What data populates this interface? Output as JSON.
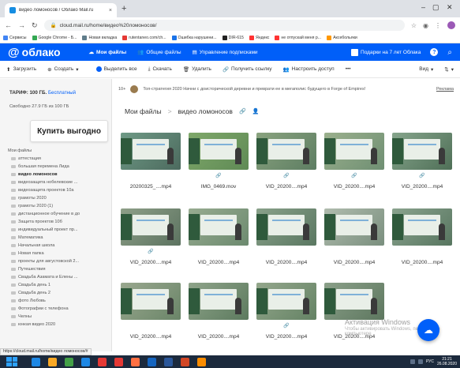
{
  "browser": {
    "tab_title": "видео ломоносов / Облако Mail.ru",
    "tab_close": "×",
    "new_tab": "+",
    "url": "cloud.mail.ru/home/видео%20ломоносов/",
    "bookmarks": [
      {
        "label": "Сервисы",
        "color": "#4285f4"
      },
      {
        "label": "Google Chrome - Б...",
        "color": "#34a853"
      },
      {
        "label": "Новая вкладка",
        "color": "#607d8b"
      },
      {
        "label": "rutentaneo.com/ch...",
        "color": "#e53935"
      },
      {
        "label": "Ошибка нарушени...",
        "color": "#1a73e8"
      },
      {
        "label": "DIR-615",
        "color": "#222222"
      },
      {
        "label": "Яндекс",
        "color": "#ff3333"
      },
      {
        "label": "не отпускай меня р...",
        "color": "#ff3333"
      },
      {
        "label": "Аксебольяки",
        "color": "#ff9800"
      }
    ]
  },
  "cloud": {
    "logo": "облако",
    "logo_at": "@",
    "nav": [
      {
        "label": "Мои файлы",
        "active": true
      },
      {
        "label": "Общие файлы",
        "active": false
      },
      {
        "label": "Управление подписками",
        "active": false
      }
    ],
    "promo_offer": "Подарки на 7 лет Облака",
    "help": "?",
    "search_icon": "⌕"
  },
  "toolbar": {
    "upload": "Загрузить",
    "create": "Создать",
    "select_all": "Выделить все",
    "download": "Скачать",
    "delete": "Удалить",
    "get_link": "Получить ссылку",
    "access": "Настроить доступ",
    "more": "•••",
    "view": "Вид",
    "sort": "⇅"
  },
  "sidebar": {
    "tariff_label": "ТАРИФ: 100 ГБ.",
    "tariff_plan": "Бесплатный",
    "free_space": "Свободно 27.9 ГБ из 100 ГБ",
    "buy_button": "Купить выгодно",
    "folders_title": "Мои файлы",
    "folders": [
      "аттестация",
      "большая перемена Лида",
      "видео ломоносов",
      "видеозащита нобелевские ...",
      "видеозащита проектов 10а",
      "грамоты 2020",
      "грамоты 2020 (1)",
      "дистанционное обучение в до",
      "Защита проектов 10б",
      "индивидуальный проект пр...",
      "Математика",
      "Начальная школа",
      "Новая папка",
      "проекты для августовской 2...",
      "Путешествия",
      "Свадьба Азамата и Елены ...",
      "Свадьба день 1",
      "Свадьба день 2",
      "фото Любовь",
      "Фотографии с телефона",
      "Челны",
      "юнкая видео 2020"
    ],
    "active_folder_index": 2
  },
  "promo": {
    "badge": "10+",
    "text": "Топ-стратегия 2020  Начни с доисторической деревни и преврати ее в мегаполис будущего в Forge of Empires!",
    "link": "Реклама"
  },
  "breadcrumbs": {
    "root": "Мои файлы",
    "separator": ">",
    "current": "видео ломоносов"
  },
  "files": [
    {
      "name": "20200325_....mp4",
      "shared": false,
      "palette": [
        "#6f9a86",
        "#4c6a5e"
      ]
    },
    {
      "name": "IMG_0469.mov",
      "shared": true,
      "palette": [
        "#7fa86a",
        "#5f8a55"
      ]
    },
    {
      "name": "VID_20200....mp4",
      "shared": true,
      "palette": [
        "#8aa37f",
        "#5d7d62"
      ]
    },
    {
      "name": "VID_20200....mp4",
      "shared": true,
      "palette": [
        "#9bb08d",
        "#6f8f73"
      ]
    },
    {
      "name": "VID_20200....mp4",
      "shared": true,
      "palette": [
        "#86a58c",
        "#4f6f57"
      ]
    },
    {
      "name": "VID_20200....mp4",
      "shared": true,
      "palette": [
        "#8e9f88",
        "#5c7360"
      ]
    },
    {
      "name": "VID_20200....mp4",
      "shared": false,
      "palette": [
        "#97ab90",
        "#6c8a6f"
      ]
    },
    {
      "name": "VID_20200....mp4",
      "shared": false,
      "palette": [
        "#89a18a",
        "#5a7761"
      ]
    },
    {
      "name": "VID_20200....mp4",
      "shared": false,
      "palette": [
        "#b0bcae",
        "#7a8f7e"
      ]
    },
    {
      "name": "VID_20200....mp4",
      "shared": false,
      "palette": [
        "#8aa38e",
        "#587660"
      ]
    },
    {
      "name": "VID_20200....mp4",
      "shared": false,
      "palette": [
        "#9aa88f",
        "#6a8568"
      ]
    },
    {
      "name": "VID_20200....mp4",
      "shared": false,
      "palette": [
        "#8fa48a",
        "#5c7a5e"
      ]
    },
    {
      "name": "VID_20200....mp4",
      "shared": true,
      "palette": [
        "#94a78c",
        "#648264"
      ]
    },
    {
      "name": "VID_20200....mp4",
      "shared": false,
      "palette": [
        "#8ba089",
        "#5d775f"
      ]
    }
  ],
  "fab_icon": "☁",
  "activation": {
    "title": "Активация Windows",
    "subtitle": "Чтобы активировать Windows, перейдите в компьютере"
  },
  "status_url": "https://cloud.mail.ru/home/видео ломоносов/#",
  "taskbar": {
    "apps": [
      "#1e88e5",
      "#f9a825",
      "#43a047",
      "#1e88e5",
      "#e53935",
      "#e53935",
      "#ff7043",
      "#1565c0",
      "#2b579a",
      "#d24726",
      "#fb8c00"
    ],
    "tray_lang": "РУС",
    "time": "21:21",
    "date": "26.08.2020"
  }
}
